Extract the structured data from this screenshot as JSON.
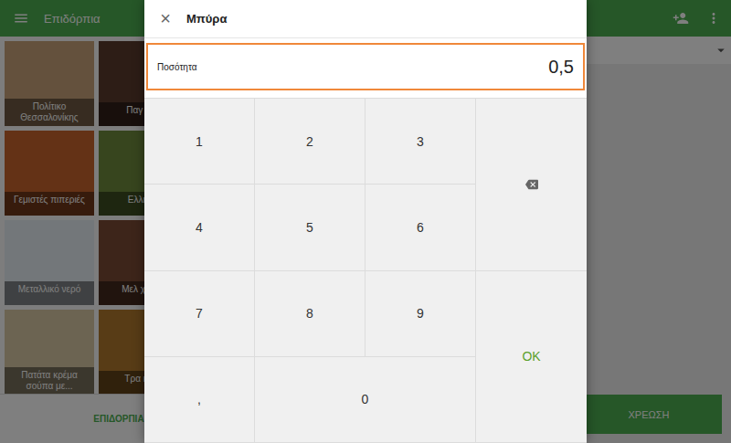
{
  "app_bar": {
    "title": "Επιδόρπια"
  },
  "tiles": [
    {
      "label": "Πολίτικο Θεσσαλονίκης",
      "color": "#c9a27a"
    },
    {
      "label": "Παγ Σοκ",
      "color": "#5a3a2c"
    },
    {
      "label": "Γεμιστές πιπεριές",
      "color": "#c8642c"
    },
    {
      "label": "Ελληνικ",
      "color": "#6f8a3c"
    },
    {
      "label": "Μεταλλικό νερό",
      "color": "#e6eef4"
    },
    {
      "label": "Μελ χοραγ",
      "color": "#7a4a34"
    },
    {
      "label": "Πατάτα κρέμα σούπα με...",
      "color": "#d9c9a4"
    },
    {
      "label": "Τρα κουλ",
      "color": "#b0782c"
    }
  ],
  "bottom_tab": {
    "label": "ΕΠΙΔΟΡΠΙΑ"
  },
  "charge_button": {
    "label": "ΧΡΕΩΣΗ"
  },
  "dialog": {
    "close": "×",
    "title": "Μπύρα",
    "field": {
      "label": "Ποσότητα",
      "value": "0,5",
      "focused": true
    },
    "keys": [
      {
        "label": "1",
        "kind": "digit"
      },
      {
        "label": "2",
        "kind": "digit"
      },
      {
        "label": "3",
        "kind": "digit"
      },
      {
        "label": "4",
        "kind": "digit"
      },
      {
        "label": "5",
        "kind": "digit"
      },
      {
        "label": "6",
        "kind": "digit"
      },
      {
        "label": "7",
        "kind": "digit"
      },
      {
        "label": "8",
        "kind": "digit"
      },
      {
        "label": "9",
        "kind": "digit"
      },
      {
        "label": ",",
        "kind": "digit"
      },
      {
        "label": "0",
        "kind": "wide"
      }
    ],
    "ok": "OK"
  }
}
